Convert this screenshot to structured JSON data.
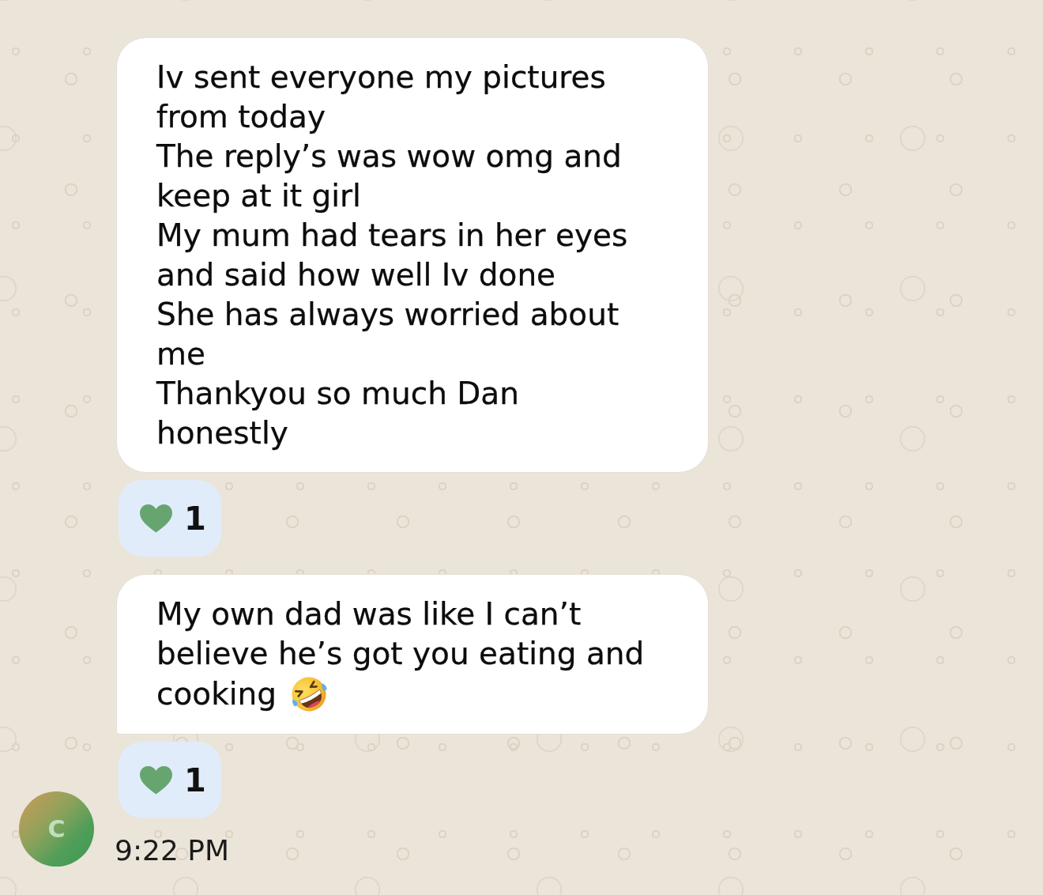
{
  "messages": [
    {
      "parts": [
        {
          "kind": "text",
          "text": "Iv sent everyone my pictures from today\nThe reply’s was wow omg and keep at it girl\nMy mum had tears in her eyes and said how well Iv done\nShe has always worried about me\nThankyou so much Dan honestly"
        }
      ],
      "tail": false,
      "reaction": {
        "count": "1"
      }
    },
    {
      "parts": [
        {
          "kind": "text",
          "text": "My own dad was like I can’t believe he’s got you eating and"
        },
        {
          "kind": "text",
          "text": "cooking"
        },
        {
          "kind": "laughing-emoji"
        }
      ],
      "tail": true,
      "reaction": {
        "count": "1"
      }
    }
  ],
  "avatar": {
    "initial": "C"
  },
  "time": "9:22 PM"
}
